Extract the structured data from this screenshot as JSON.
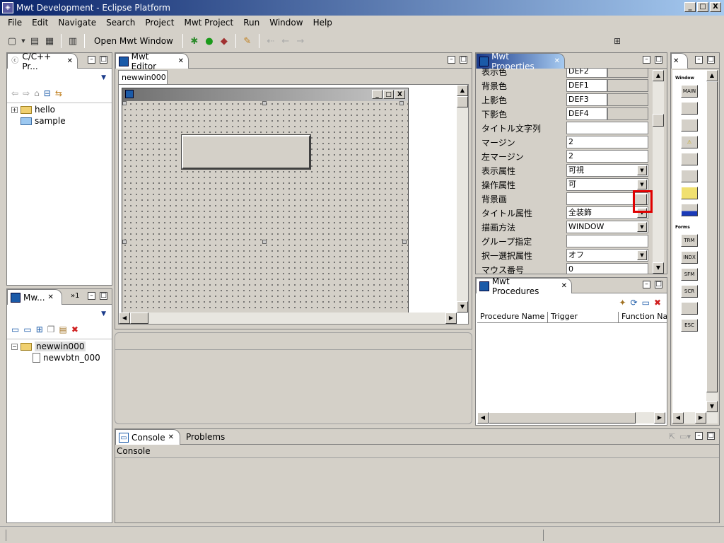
{
  "window": {
    "title": "Mwt Development - Eclipse Platform",
    "min": "_",
    "max": "□",
    "close": "X"
  },
  "menu": [
    "File",
    "Edit",
    "Navigate",
    "Search",
    "Project",
    "Mwt Project",
    "Run",
    "Window",
    "Help"
  ],
  "toolbar": {
    "open_mwt_window": "Open Mwt Window"
  },
  "cpp_panel": {
    "tab": "C/C++ Pr...",
    "items": [
      "hello",
      "sample"
    ]
  },
  "mwt_panel": {
    "tab": "Mw...",
    "overflow": "»1",
    "items": [
      "newwin000",
      "newvbtn_000"
    ]
  },
  "editor": {
    "tab": "Mwt Editor",
    "subtab": "newwin000"
  },
  "properties": {
    "tab": "Mwt Properties",
    "rows": [
      {
        "name": "表示色",
        "value": "DEF2",
        "kind": "color"
      },
      {
        "name": "背景色",
        "value": "DEF1",
        "kind": "color"
      },
      {
        "name": "上影色",
        "value": "DEF3",
        "kind": "color"
      },
      {
        "name": "下影色",
        "value": "DEF4",
        "kind": "color"
      },
      {
        "name": "タイトル文字列",
        "value": "",
        "kind": "text"
      },
      {
        "name": "マージン",
        "value": "2",
        "kind": "text"
      },
      {
        "name": "左マージン",
        "value": "2",
        "kind": "text"
      },
      {
        "name": "表示属性",
        "value": "可視",
        "kind": "dropdown"
      },
      {
        "name": "操作属性",
        "value": "可",
        "kind": "dropdown"
      },
      {
        "name": "背景画",
        "value": "",
        "kind": "button"
      },
      {
        "name": "タイトル属性",
        "value": "全装飾",
        "kind": "dropdown"
      },
      {
        "name": "描画方法",
        "value": "WINDOW",
        "kind": "dropdown"
      },
      {
        "name": "グループ指定",
        "value": "",
        "kind": "text"
      },
      {
        "name": "択一選択属性",
        "value": "オフ",
        "kind": "dropdown"
      },
      {
        "name": "マウス番号",
        "value": "0",
        "kind": "text"
      }
    ]
  },
  "procedures": {
    "tab": "Mwt Procedures",
    "columns": [
      "Procedure Name",
      "Trigger",
      "Function Na"
    ]
  },
  "palette": {
    "section_window": "Window",
    "items1": [
      "MAIN",
      "",
      "",
      "⚠",
      "",
      "",
      ""
    ],
    "section_forms": "Forms",
    "items2": [
      "TRM",
      "INDX",
      "SFM",
      "SCR",
      "",
      "ESC"
    ]
  },
  "bottom": {
    "tabs": [
      "Console",
      "Problems"
    ],
    "content": "Console"
  },
  "colors": {
    "highlight": "#e00000",
    "accent": "#0a246a"
  }
}
